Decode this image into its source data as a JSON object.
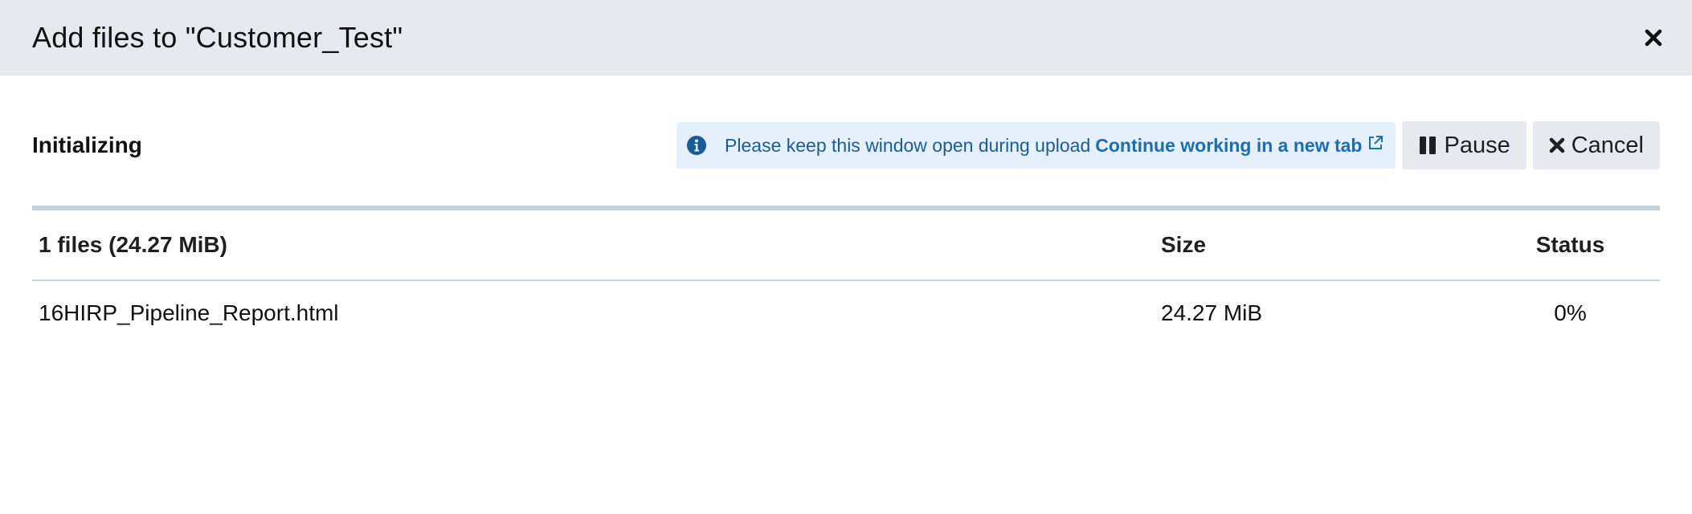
{
  "modal": {
    "title": "Add files to \"Customer_Test\"",
    "close_icon": "close-icon"
  },
  "toolbar": {
    "state_label": "Initializing",
    "info": {
      "icon": "info-circle-icon",
      "message": "Please keep this window open during upload",
      "link_label": "Continue working in a new tab",
      "link_icon": "external-link-icon"
    },
    "pause_label": "Pause",
    "pause_icon": "pause-icon",
    "cancel_label": "Cancel",
    "cancel_icon": "close-icon"
  },
  "progress": {
    "fraction": 0
  },
  "table": {
    "columns": [
      "1 files (24.27 MiB)",
      "Size",
      "Status"
    ],
    "rows": [
      [
        "16HIRP_Pipeline_Report.html",
        "24.27 MiB",
        "0%"
      ]
    ]
  },
  "colors": {
    "header_bg": "#e6e9ee",
    "info_bg": "#e5f0fa",
    "info_text": "#1a5c99",
    "link": "#1b6db5",
    "button_bg": "#e6e9ee",
    "progress_track": "#c4d0dc"
  }
}
